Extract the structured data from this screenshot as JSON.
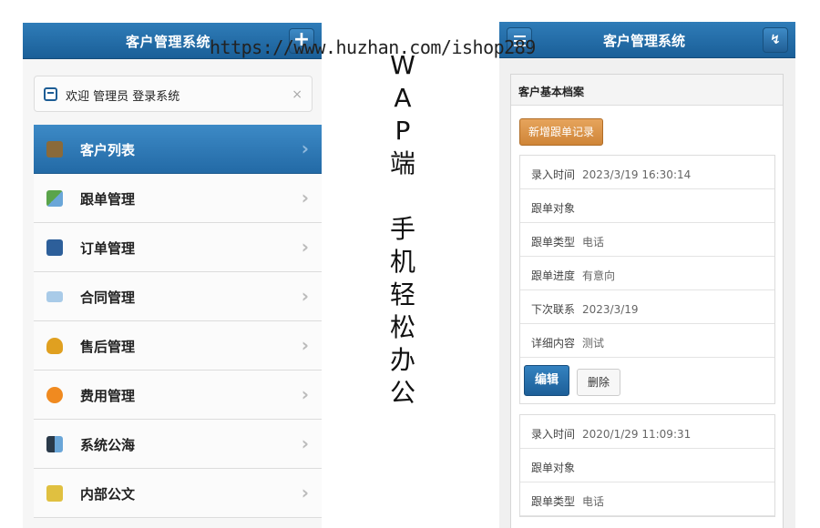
{
  "left": {
    "title": "客户管理系统",
    "welcome": "欢迎 管理员 登录系统",
    "close": "×",
    "plus": "+",
    "menu": [
      {
        "label": "客户列表",
        "icon": "user-icon",
        "color": "#8a6a3a",
        "active": true
      },
      {
        "label": "跟单管理",
        "icon": "exchange-arrows-icon",
        "color": "#5aa44a",
        "active": false
      },
      {
        "label": "订单管理",
        "icon": "order-box-icon",
        "color": "#2d5f9a",
        "active": false
      },
      {
        "label": "合同管理",
        "icon": "contract-icon",
        "color": "#6aa6d8",
        "active": false
      },
      {
        "label": "售后管理",
        "icon": "award-ribbon-icon",
        "color": "#e0a020",
        "active": false
      },
      {
        "label": "费用管理",
        "icon": "piggy-bank-icon",
        "color": "#f08a20",
        "active": false
      },
      {
        "label": "系统公海",
        "icon": "grid-blocks-icon",
        "color": "#2a3a4a",
        "active": false
      },
      {
        "label": "内部公文",
        "icon": "document-icon",
        "color": "#e0c040",
        "active": false
      }
    ]
  },
  "overlay": {
    "url": "https://www.huzhan.com/ishop289",
    "vertical_top": [
      "W",
      "A",
      "P",
      "端"
    ],
    "vertical_bottom": [
      "手",
      "机",
      "轻",
      "松",
      "办",
      "公"
    ]
  },
  "right": {
    "title": "客户管理系统",
    "panel_title": "客户基本档案",
    "add_button": "新增跟单记录",
    "edit_button": "编辑",
    "delete_button": "删除",
    "records": [
      {
        "rows": [
          {
            "key": "录入时间",
            "value": "2023/3/19 16:30:14"
          },
          {
            "key": "跟单对象",
            "value": ""
          },
          {
            "key": "跟单类型",
            "value": "电话"
          },
          {
            "key": "跟单进度",
            "value": "有意向"
          },
          {
            "key": "下次联系",
            "value": "2023/3/19"
          },
          {
            "key": "详细内容",
            "value": "测试"
          }
        ]
      },
      {
        "rows": [
          {
            "key": "录入时间",
            "value": "2020/1/29 11:09:31"
          },
          {
            "key": "跟单对象",
            "value": ""
          },
          {
            "key": "跟单类型",
            "value": "电话"
          }
        ]
      }
    ]
  }
}
